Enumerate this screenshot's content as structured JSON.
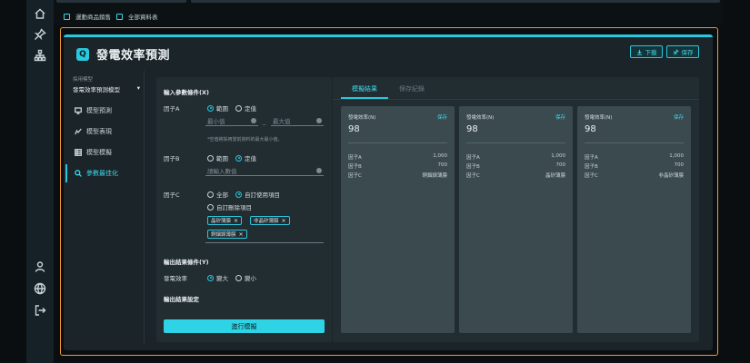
{
  "rail": {
    "top_icons": [
      "home-icon",
      "pin-icon",
      "org-chart-icon"
    ],
    "bottom_icons": [
      "user-icon",
      "globe-icon",
      "logout-icon"
    ]
  },
  "breadcrumb": {
    "item1": "運動商品銷售",
    "item2": "全部資料表"
  },
  "header": {
    "badge": "Q",
    "title": "發電效率預測",
    "download_label": "下載",
    "save_label": "保存"
  },
  "menu": {
    "model_label": "採用模型",
    "model_value": "發電效率預測模型",
    "items": [
      {
        "label": "模型預測",
        "icon": "monitor-icon"
      },
      {
        "label": "模型表現",
        "icon": "chart-icon"
      },
      {
        "label": "模型模擬",
        "icon": "table-icon"
      },
      {
        "label": "參數最佳化",
        "icon": "search-icon"
      }
    ]
  },
  "form": {
    "input_heading": "輸入參數條件(X)",
    "factorA": {
      "label": "因子A",
      "opt_range": "範圍",
      "opt_fixed": "定值",
      "min_placeholder": "最小值",
      "dash": "_",
      "max_placeholder": "最大值",
      "hint": "*空值將採用當前資料的最大最小值。"
    },
    "factorB": {
      "label": "因子B",
      "opt_range": "範圍",
      "opt_fixed": "定值",
      "placeholder": "請輸入數值"
    },
    "factorC": {
      "label": "因子C",
      "opt_all": "全部",
      "opt_custom_use": "自訂使用項目",
      "opt_custom_remove": "自訂刪除項目",
      "chips": [
        "晶矽薄膜",
        "非晶矽薄膜",
        "銅銦鎵薄膜"
      ]
    },
    "output_heading": "輸出結果條件(Y)",
    "output": {
      "label": "發電效率",
      "opt_max": "變大",
      "opt_min": "變小"
    },
    "settings_heading": "輸出結果設定",
    "run_button": "進行模擬"
  },
  "results": {
    "tabs": [
      "模擬結果",
      "保存紀錄"
    ],
    "cards": [
      {
        "title": "發電效率(N)",
        "save": "保存",
        "value": "98",
        "rows": [
          [
            "因子A",
            "1,000"
          ],
          [
            "因子B",
            "700"
          ],
          [
            "因子C",
            "銅銦鎵薄膜"
          ]
        ]
      },
      {
        "title": "發電效率(N)",
        "save": "保存",
        "value": "98",
        "rows": [
          [
            "因子A",
            "1,000"
          ],
          [
            "因子B",
            "700"
          ],
          [
            "因子C",
            "晶矽薄膜"
          ]
        ]
      },
      {
        "title": "發電效率(N)",
        "save": "保存",
        "value": "98",
        "rows": [
          [
            "因子A",
            "1,000"
          ],
          [
            "因子B",
            "700"
          ],
          [
            "因子C",
            "非晶矽薄膜"
          ]
        ]
      }
    ]
  },
  "colors": {
    "accent": "#29c8dc",
    "highlight_frame": "#f29a2e",
    "panel": "#1b2429",
    "card": "#3a4a4f"
  }
}
